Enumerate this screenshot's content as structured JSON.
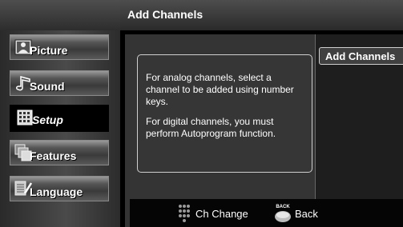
{
  "header": {
    "title": "Add Channels"
  },
  "sidebar": {
    "items": [
      {
        "label": "Picture",
        "icon": "picture-icon",
        "selected": false
      },
      {
        "label": "Sound",
        "icon": "sound-icon",
        "selected": false
      },
      {
        "label": "Setup",
        "icon": "setup-icon",
        "selected": true
      },
      {
        "label": "Features",
        "icon": "features-icon",
        "selected": false
      },
      {
        "label": "Language",
        "icon": "language-icon",
        "selected": false
      }
    ]
  },
  "main": {
    "info": [
      "For analog channels, select a channel to be added using number keys.",
      "For digital channels, you must perform Autoprogram function."
    ],
    "option_label": "Add Channels"
  },
  "footer": {
    "ch_change_label": "Ch Change",
    "back_key_text": "BACK",
    "back_label": "Back"
  },
  "colors": {
    "background": "#000000",
    "text": "#ffffff",
    "panel": "#343434",
    "border": "#cfcfcf"
  }
}
